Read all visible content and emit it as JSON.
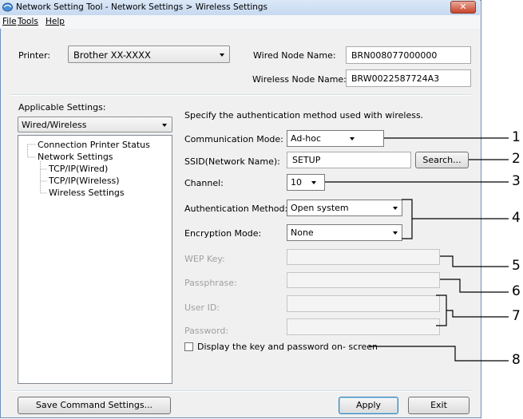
{
  "window": {
    "title": "Network Setting Tool - Network Settings > Wireless Settings",
    "close_glyph": "✕"
  },
  "menu": {
    "file": "File",
    "tools": "Tools",
    "help": "Help"
  },
  "printer": {
    "label": "Printer:",
    "value": "Brother XX-XXXX"
  },
  "wired_node": {
    "label": "Wired Node Name:",
    "value": "BRN008077000000"
  },
  "wireless_node": {
    "label": "Wireless Node Name:",
    "value": "BRW0022587724A3"
  },
  "applicable": {
    "label": "Applicable Settings:",
    "value": "Wired/Wireless"
  },
  "tree": {
    "root1": "Connection Printer Status",
    "root2": "Network Settings",
    "child1": "TCP/IP(Wired)",
    "child2": "TCP/IP(Wireless)",
    "child3": "Wireless Settings"
  },
  "intro": "Specify the authentication method used with wireless.",
  "comm_mode": {
    "label": "Communication Mode:",
    "value": "Ad-hoc"
  },
  "ssid": {
    "label": "SSID(Network Name):",
    "value": "SETUP",
    "search_label": "Search..."
  },
  "channel": {
    "label": "Channel:",
    "value": "10"
  },
  "auth": {
    "label": "Authentication Method:",
    "value": "Open system"
  },
  "encryption": {
    "label": "Encryption Mode:",
    "value": "None"
  },
  "wep": {
    "label": "WEP Key:",
    "value": ""
  },
  "passphrase": {
    "label": "Passphrase:",
    "value": ""
  },
  "userid": {
    "label": "User ID:",
    "value": ""
  },
  "password": {
    "label": "Password:",
    "value": ""
  },
  "display_key": {
    "label": "Display the key and password on- screen",
    "checked": false
  },
  "buttons": {
    "save": "Save Command Settings...",
    "apply": "Apply",
    "exit": "Exit"
  },
  "callouts": [
    "1",
    "2",
    "3",
    "4",
    "5",
    "6",
    "7",
    "8"
  ]
}
